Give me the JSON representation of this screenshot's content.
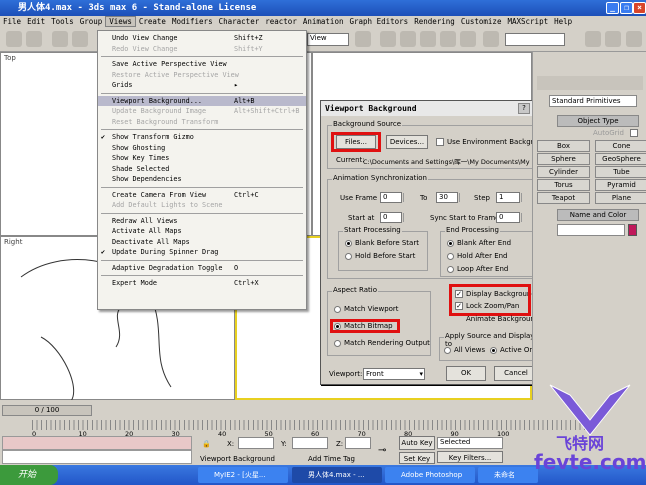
{
  "window": {
    "title": "男人体4.max - 3ds max 6 - Stand-alone License"
  },
  "menubar": [
    "File",
    "Edit",
    "Tools",
    "Group",
    "Views",
    "Create",
    "Modifiers",
    "Character",
    "reactor",
    "Animation",
    "Graph Editors",
    "Rendering",
    "Customize",
    "MAXScript",
    "Help"
  ],
  "toolbar": {
    "view_dropdown": "View"
  },
  "views_menu": [
    {
      "label": "Undo View Change",
      "shortcut": "Shift+Z",
      "disabled": false
    },
    {
      "label": "Redo View Change",
      "shortcut": "Shift+Y",
      "disabled": true
    },
    {
      "sep": true
    },
    {
      "label": "Save Active Perspective View",
      "shortcut": "",
      "disabled": false
    },
    {
      "label": "Restore Active Perspective View",
      "shortcut": "",
      "disabled": true
    },
    {
      "label": "Grids",
      "shortcut": "▸",
      "disabled": false
    },
    {
      "sep": true
    },
    {
      "label": "Viewport Background...",
      "shortcut": "Alt+B",
      "disabled": false,
      "highlight": true
    },
    {
      "label": "Update Background Image",
      "shortcut": "Alt+Shift+Ctrl+B",
      "disabled": true
    },
    {
      "label": "Reset Background Transform",
      "shortcut": "",
      "disabled": true
    },
    {
      "sep": true
    },
    {
      "label": "Show Transform Gizmo",
      "shortcut": "",
      "checked": true
    },
    {
      "label": "Show Ghosting",
      "shortcut": ""
    },
    {
      "label": "Show Key Times",
      "shortcut": ""
    },
    {
      "label": "Shade Selected",
      "shortcut": ""
    },
    {
      "label": "Show Dependencies",
      "shortcut": ""
    },
    {
      "sep": true
    },
    {
      "label": "Create Camera From View",
      "shortcut": "Ctrl+C"
    },
    {
      "label": "Add Default Lights to Scene",
      "shortcut": "",
      "disabled": true
    },
    {
      "sep": true
    },
    {
      "label": "Redraw All Views",
      "shortcut": ""
    },
    {
      "label": "Activate All Maps",
      "shortcut": ""
    },
    {
      "label": "Deactivate All Maps",
      "shortcut": ""
    },
    {
      "label": "Update During Spinner Drag",
      "shortcut": "",
      "checked": true
    },
    {
      "sep": true
    },
    {
      "label": "Adaptive Degradation Toggle",
      "shortcut": "O"
    },
    {
      "sep": true
    },
    {
      "label": "Expert Mode",
      "shortcut": "Ctrl+X"
    }
  ],
  "viewports": {
    "top": "Top",
    "right": "Right"
  },
  "dialog": {
    "title": "Viewport Background",
    "help": "?",
    "bg_source": {
      "label": "Background Source",
      "files": "Files...",
      "devices": "Devices...",
      "use_env": "Use Environment Background",
      "current_label": "Current:",
      "current_path": "C:\\Documents and Settings\\晖一\\My Documents\\My"
    },
    "anim": {
      "label": "Animation Synchronization",
      "use_frame": "Use Frame",
      "use_frame_val": "0",
      "to": "To",
      "to_val": "30",
      "step": "Step",
      "step_val": "1",
      "start_at": "Start at",
      "start_at_val": "0",
      "sync": "Sync Start to Frame",
      "sync_val": "0"
    },
    "start_proc": {
      "label": "Start Processing",
      "options": [
        "Blank Before Start",
        "Hold Before Start"
      ],
      "selected": 0
    },
    "end_proc": {
      "label": "End Processing",
      "options": [
        "Blank After End",
        "Hold After End",
        "Loop After End"
      ],
      "selected": 0
    },
    "aspect": {
      "label": "Aspect Ratio",
      "options": [
        "Match Viewport",
        "Match Bitmap",
        "Match Rendering Output"
      ],
      "selected": 1
    },
    "display_bg": "Display Background",
    "lock_zoom": "Lock Zoom/Pan",
    "animate_bg": "Animate Background",
    "apply": {
      "label": "Apply Source and Display to",
      "options": [
        "All Views",
        "Active Only"
      ],
      "selected": 1
    },
    "viewport_label": "Viewport:",
    "viewport_value": "Front",
    "ok": "OK",
    "cancel": "Cancel",
    "highlight_color": "#e01010"
  },
  "command_panel": {
    "dropdown": "Standard Primitives",
    "object_type": "Object Type",
    "autogrid": "AutoGrid",
    "buttons": [
      "Box",
      "Cone",
      "Sphere",
      "GeoSphere",
      "Cylinder",
      "Tube",
      "Torus",
      "Pyramid",
      "Teapot",
      "Plane"
    ],
    "name_color": "Name and Color",
    "color_swatch": "#c0185a"
  },
  "timeline": {
    "frame": "0 / 100",
    "ticks": [
      "0",
      "10",
      "20",
      "30",
      "40",
      "50",
      "60",
      "70",
      "80",
      "90",
      "100"
    ]
  },
  "status": {
    "x": "X:",
    "y": "Y:",
    "z": "Z:",
    "prompt": "Viewport Background",
    "add_time_tag": "Add Time Tag",
    "auto_key": "Auto Key",
    "set_key": "Set Key",
    "selected": "Selected",
    "key_filters": "Key Filters..."
  },
  "taskbar": {
    "start": "开始",
    "tasks": [
      "MyIE2 - [火星...",
      "男人体4.max - ...",
      "Adobe Photoshop",
      "未命名"
    ]
  },
  "watermark": {
    "text1": "飞特网",
    "text2": "fevte.com"
  }
}
